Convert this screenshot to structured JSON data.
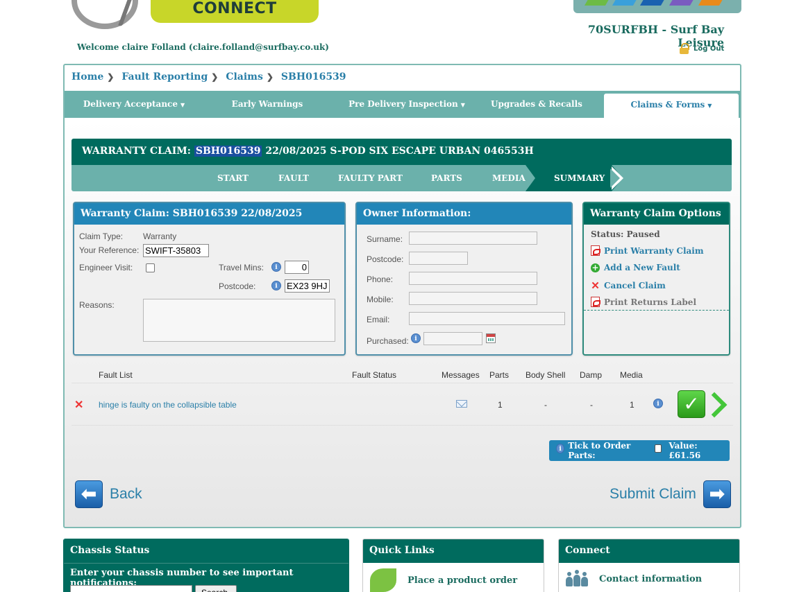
{
  "header": {
    "brand": "CONNECT",
    "dealer": "70SURFBH - Surf Bay Leisure",
    "welcome": "Welcome claire Folland (claire.folland@surfbay.co.uk)",
    "logout": "Log Out"
  },
  "colors": {
    "teal": "#006b5e",
    "teal_light": "#6bb1ab",
    "blue": "#2286b8",
    "link": "#2a7fa8",
    "brand_lime": "#c8d629"
  },
  "breadcrumb": [
    "Home",
    "Fault Reporting",
    "Claims",
    "SBH016539"
  ],
  "nav": {
    "tabs": [
      {
        "label": "Delivery Acceptance",
        "dropdown": true
      },
      {
        "label": "Early Warnings",
        "dropdown": false
      },
      {
        "label": "Pre Delivery Inspection",
        "dropdown": true
      },
      {
        "label": "Upgrades & Recalls",
        "dropdown": false
      },
      {
        "label": "Claims & Forms",
        "dropdown": true,
        "active": true
      }
    ]
  },
  "claim": {
    "title_prefix": "WARRANTY CLAIM: ",
    "claim_id": "SBH016539",
    "title_suffix": " 22/08/2025 S-POD SIX ESCAPE URBAN 046553H"
  },
  "steps": [
    "START",
    "FAULT",
    "FAULTY PART",
    "PARTS",
    "MEDIA",
    "SUMMARY"
  ],
  "warranty_panel": {
    "title": "Warranty Claim: SBH016539 22/08/2025",
    "claim_type_label": "Claim Type:",
    "claim_type_value": "Warranty",
    "your_ref_label": "Your Reference:",
    "your_ref_value": "SWIFT-35803",
    "engineer_visit_label": "Engineer Visit:",
    "travel_mins_label": "Travel Mins:",
    "travel_mins_value": "0",
    "postcode_label": "Postcode:",
    "postcode_value": "EX23 9HJ",
    "reasons_label": "Reasons:"
  },
  "owner_panel": {
    "title": "Owner Information:",
    "surname_label": "Surname:",
    "postcode_label": "Postcode:",
    "phone_label": "Phone:",
    "mobile_label": "Mobile:",
    "email_label": "Email:",
    "purchased_label": "Purchased:"
  },
  "options_panel": {
    "title": "Warranty Claim Options",
    "status": "Status: Paused",
    "print_claim": "Print Warranty Claim",
    "add_fault": "Add a New Fault",
    "cancel_claim": "Cancel Claim",
    "print_returns": "Print Returns Label"
  },
  "fault_list": {
    "headers": {
      "fault_list": "Fault List",
      "fault_status": "Fault Status",
      "messages": "Messages",
      "parts": "Parts",
      "body_shell": "Body Shell",
      "damp": "Damp",
      "media": "Media"
    },
    "rows": [
      {
        "description": "hinge is faulty on the collapsible table",
        "parts": "1",
        "body_shell": "-",
        "damp": "-",
        "media": "1"
      }
    ]
  },
  "order": {
    "label": "Tick to Order Parts:",
    "value": "Value: £61.56"
  },
  "actions": {
    "back": "Back",
    "submit": "Submit Claim"
  },
  "bottom": {
    "chassis": {
      "title": "Chassis Status",
      "text": "Enter your chassis number to see important notifications:",
      "button": "Search"
    },
    "quick_links": {
      "title": "Quick Links",
      "item": "Place a product order"
    },
    "connect": {
      "title": "Connect",
      "item": "Contact information"
    }
  }
}
